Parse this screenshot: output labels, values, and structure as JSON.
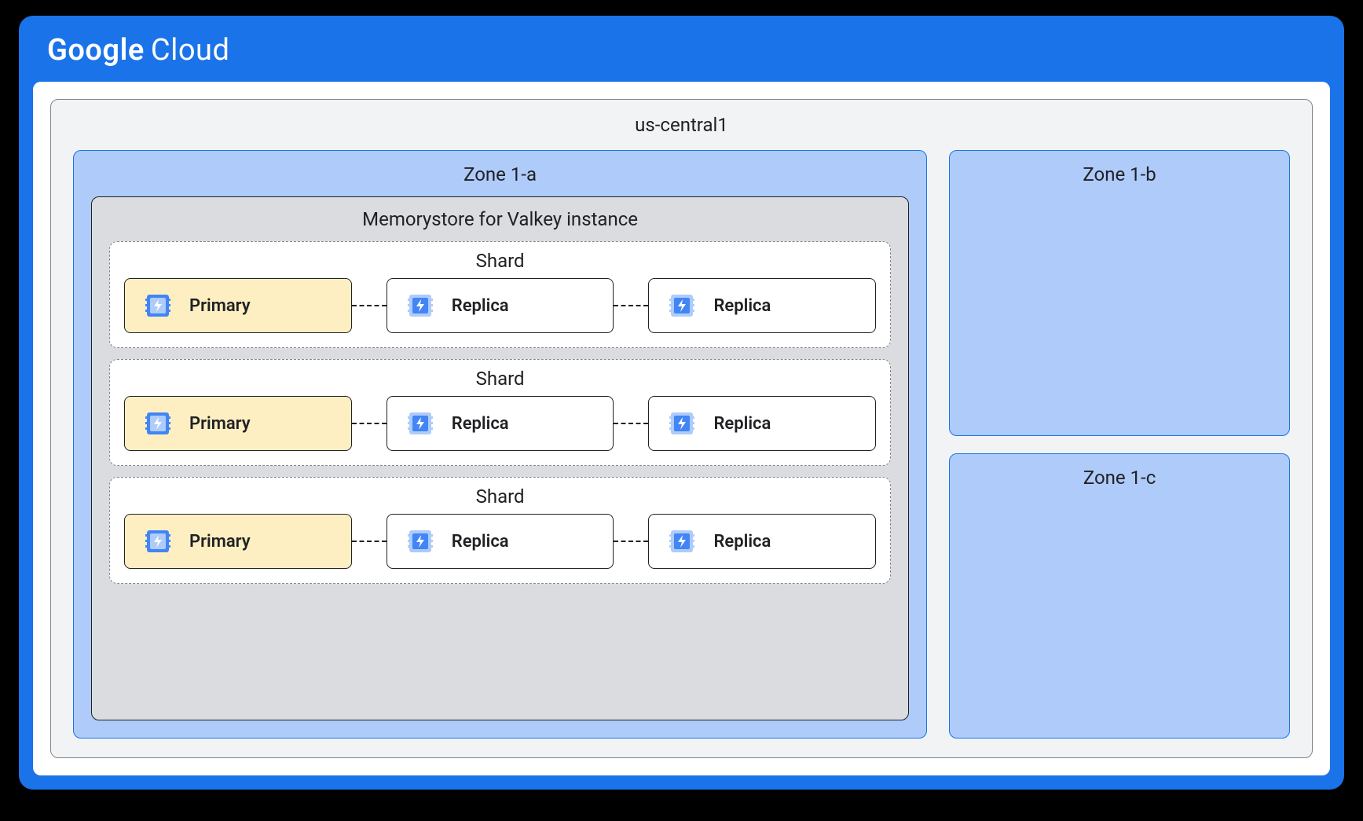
{
  "brand": {
    "left": "Google",
    "right": "Cloud"
  },
  "region": {
    "title": "us-central1",
    "zones": {
      "a": {
        "title": "Zone 1-a",
        "instance": {
          "title": "Memorystore for Valkey instance",
          "shards": [
            {
              "title": "Shard",
              "nodes": [
                {
                  "label": "Primary",
                  "kind": "primary"
                },
                {
                  "label": "Replica",
                  "kind": "replica"
                },
                {
                  "label": "Replica",
                  "kind": "replica"
                }
              ]
            },
            {
              "title": "Shard",
              "nodes": [
                {
                  "label": "Primary",
                  "kind": "primary"
                },
                {
                  "label": "Replica",
                  "kind": "replica"
                },
                {
                  "label": "Replica",
                  "kind": "replica"
                }
              ]
            },
            {
              "title": "Shard",
              "nodes": [
                {
                  "label": "Primary",
                  "kind": "primary"
                },
                {
                  "label": "Replica",
                  "kind": "replica"
                },
                {
                  "label": "Replica",
                  "kind": "replica"
                }
              ]
            }
          ]
        }
      },
      "b": {
        "title": "Zone 1-b"
      },
      "c": {
        "title": "Zone 1-c"
      }
    }
  },
  "colors": {
    "brand_blue": "#1a73e8",
    "zone_blue": "#aecbfa",
    "instance_grey": "#dadce0",
    "region_grey": "#f1f3f4",
    "primary_fill": "#feefc3",
    "black": "#000000"
  }
}
